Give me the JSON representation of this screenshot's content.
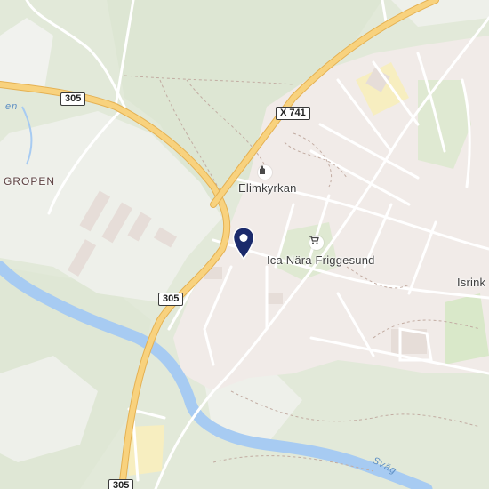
{
  "map": {
    "labels": {
      "area_gropen": "GROPEN",
      "elimkyrkan": "Elimkyrkan",
      "ica": "Ica Nära Friggesund",
      "isrink": "Isrink",
      "water_top": "en",
      "water_bottom": "Sväg"
    },
    "shields": {
      "r305_top": "305",
      "x741": "X 741",
      "r305_mid": "305",
      "r305_bottom": "305"
    },
    "icons": {
      "church": "church-icon",
      "shop": "shopping-cart-icon",
      "pin": "location-pin-icon"
    },
    "colors": {
      "background": "#e6ecdf",
      "residential": "#f1ebe8",
      "main_road": "#f5c76a",
      "water": "#a7cbf2",
      "pin": "#1b2a6b"
    }
  }
}
